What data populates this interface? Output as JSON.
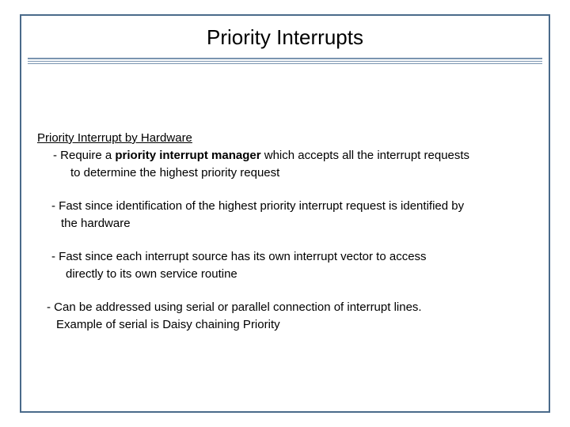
{
  "title": "Priority Interrupts",
  "heading": "Priority Interrupt  by Hardware",
  "item1_pre": "- Require a ",
  "item1_bold": "priority interrupt manager",
  "item1_post": " which accepts all the interrupt requests",
  "item1_line2": "to determine the highest priority request",
  "item2_line1": "- Fast since identification of the highest priority interrupt request is identified by",
  "item2_line2": "the hardware",
  "item3_line1": "- Fast since each interrupt source has its own interrupt vector to access",
  "item3_line2": "directly to its own service routine",
  "item4_line1": "- Can be addressed using serial or parallel connection of interrupt lines.",
  "item4_line2": "Example of serial is Daisy chaining Priority"
}
